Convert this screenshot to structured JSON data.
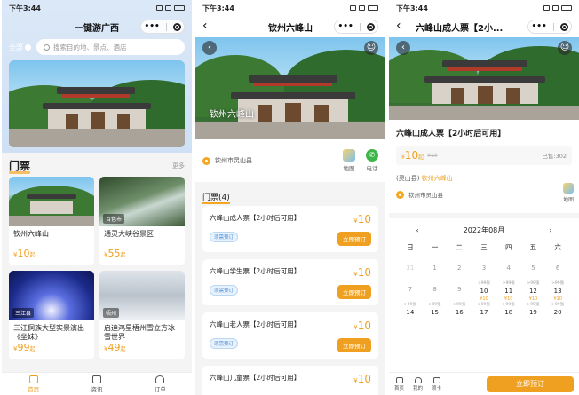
{
  "status": {
    "time": "下午3:44"
  },
  "home": {
    "title": "一键游广西",
    "city": "全部",
    "search_placeholder": "搜索目的地、景点、酒店",
    "section_title": "门票",
    "more": "更多",
    "cards": [
      {
        "name": "钦州六峰山",
        "price": "10",
        "unit": "起",
        "tag": ""
      },
      {
        "name": "通灵大峡谷景区",
        "price": "55",
        "unit": "起",
        "tag": "百色市"
      },
      {
        "name": "三江侗族大型实景演出《坐妹》",
        "price": "99",
        "unit": "起",
        "tag": "三江县"
      },
      {
        "name": "启迪鸿星梧州雪立方冰雪世界",
        "price": "49",
        "unit": "起",
        "tag": "梧州"
      }
    ],
    "tabs": [
      {
        "label": "首页"
      },
      {
        "label": "资讯"
      },
      {
        "label": "订单"
      }
    ]
  },
  "detail": {
    "title": "钦州六峰山",
    "hero_text": "钦州六峰山",
    "location": "钦州市灵山县",
    "map_label": "地图",
    "phone_label": "电话",
    "ticket_header": "门票(4)",
    "need_book": "须需预订",
    "book_label": "立即预订",
    "tickets": [
      {
        "name": "六峰山成人票【2小时后可用】",
        "price": "10"
      },
      {
        "name": "六峰山学生票【2小时后可用】",
        "price": "10"
      },
      {
        "name": "六峰山老人票【2小时后可用】",
        "price": "10"
      },
      {
        "name": "六峰山儿童票【2小时后可用】",
        "price": "10"
      }
    ]
  },
  "ticket": {
    "nav_title": "六峰山成人票【2小...",
    "title": "六峰山成人票【2小时后可用】",
    "price": "10",
    "unit": "起",
    "orig_price": "¥10",
    "sold": "已售:302",
    "spot_prefix": "(灵山县)",
    "spot_name": "钦州六峰山",
    "address": "钦州市灵山县",
    "map_label": "地图",
    "month": "2022年08月",
    "weekdays": [
      "日",
      "一",
      "二",
      "三",
      "四",
      "五",
      "六"
    ],
    "row1": [
      "31",
      "1",
      "2",
      "3",
      "4",
      "5",
      "6"
    ],
    "row2": [
      "7",
      "8",
      "9",
      "10",
      "11",
      "12",
      "13"
    ],
    "row3": [
      "14",
      "15",
      "16",
      "17",
      "18",
      "19",
      "20"
    ],
    "stock": ">99张",
    "day_price": "¥10",
    "bottom_tabs": [
      {
        "label": "首页"
      },
      {
        "label": "我的"
      },
      {
        "label": "须卡"
      }
    ],
    "buy_label": "立即预订"
  }
}
